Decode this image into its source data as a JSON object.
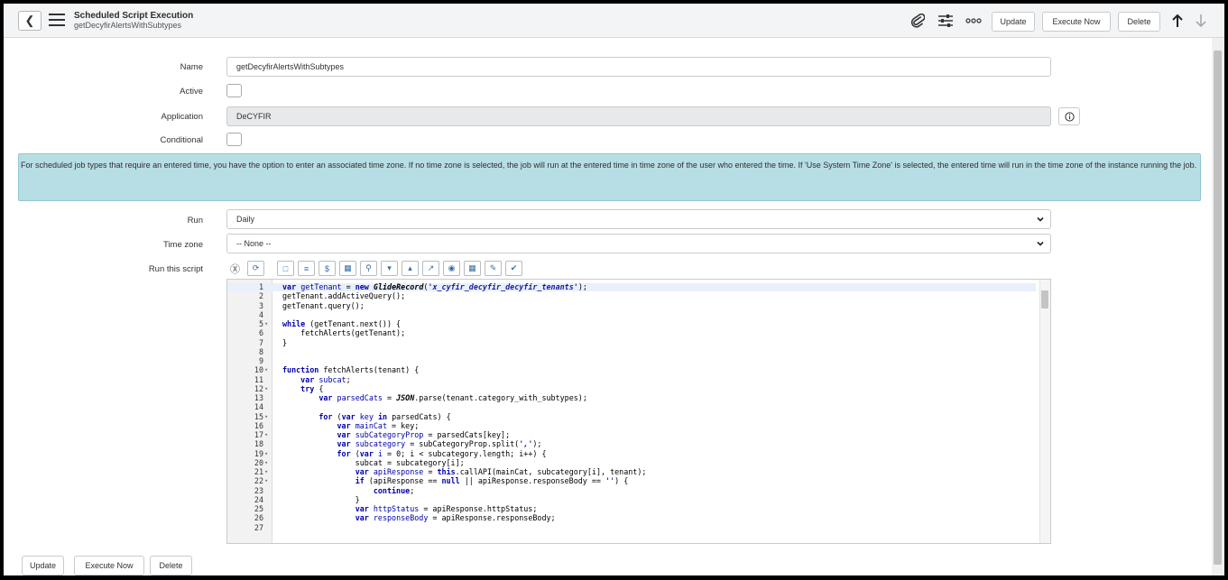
{
  "header": {
    "title": "Scheduled Script Execution",
    "subtitle": "getDecyfirAlertsWithSubtypes",
    "buttons": {
      "update": "Update",
      "execute_now": "Execute Now",
      "delete": "Delete"
    },
    "icons": [
      "attachment-icon",
      "settings-sliders-icon",
      "more-options-icon",
      "arrow-up-icon",
      "arrow-down-icon"
    ]
  },
  "form": {
    "name": {
      "label": "Name",
      "value": "getDecyfirAlertsWithSubtypes"
    },
    "active": {
      "label": "Active",
      "checked": false
    },
    "application": {
      "label": "Application",
      "value": "DeCYFIR"
    },
    "conditional": {
      "label": "Conditional",
      "checked": false
    },
    "info_message": "For scheduled job types that require an entered time, you have the option to enter an associated time zone. If no time zone is selected, the job will run at the entered time in time zone of the user who entered the time. If 'Use System Time Zone' is selected, the entered time will run in the time zone of the instance running the job.",
    "run": {
      "label": "Run",
      "value": "Daily"
    },
    "time_zone": {
      "label": "Time zone",
      "value": "-- None --"
    },
    "script": {
      "label": "Run this script"
    }
  },
  "script_lines": [
    "var getTenant = new GlideRecord('x_cyfir_decyfir_decyfir_tenants');",
    "getTenant.addActiveQuery();",
    "getTenant.query();",
    "",
    "while (getTenant.next()) {",
    "    fetchAlerts(getTenant);",
    "}",
    "",
    "",
    "function fetchAlerts(tenant) {",
    "    var subcat;",
    "    try {",
    "        var parsedCats = JSON.parse(tenant.category_with_subtypes);",
    "",
    "        for (var key in parsedCats) {",
    "            var mainCat = key;",
    "            var subCategoryProp = parsedCats[key];",
    "            var subcategory = subCategoryProp.split(',');",
    "            for (var i = 0; i < subcategory.length; i++) {",
    "                subcat = subcategory[i];",
    "                var apiResponse = this.callAPI(mainCat, subcategory[i], tenant);",
    "                if (apiResponse == null || apiResponse.responseBody == '') {",
    "                    continue;",
    "                }",
    "                var httpStatus = apiResponse.httpStatus;",
    "                var responseBody = apiResponse.responseBody;",
    ""
  ],
  "fold_lines": [
    5,
    10,
    12,
    15,
    17,
    19,
    20,
    21,
    22
  ],
  "footer": {
    "update": "Update",
    "execute_now": "Execute Now",
    "delete": "Delete"
  }
}
